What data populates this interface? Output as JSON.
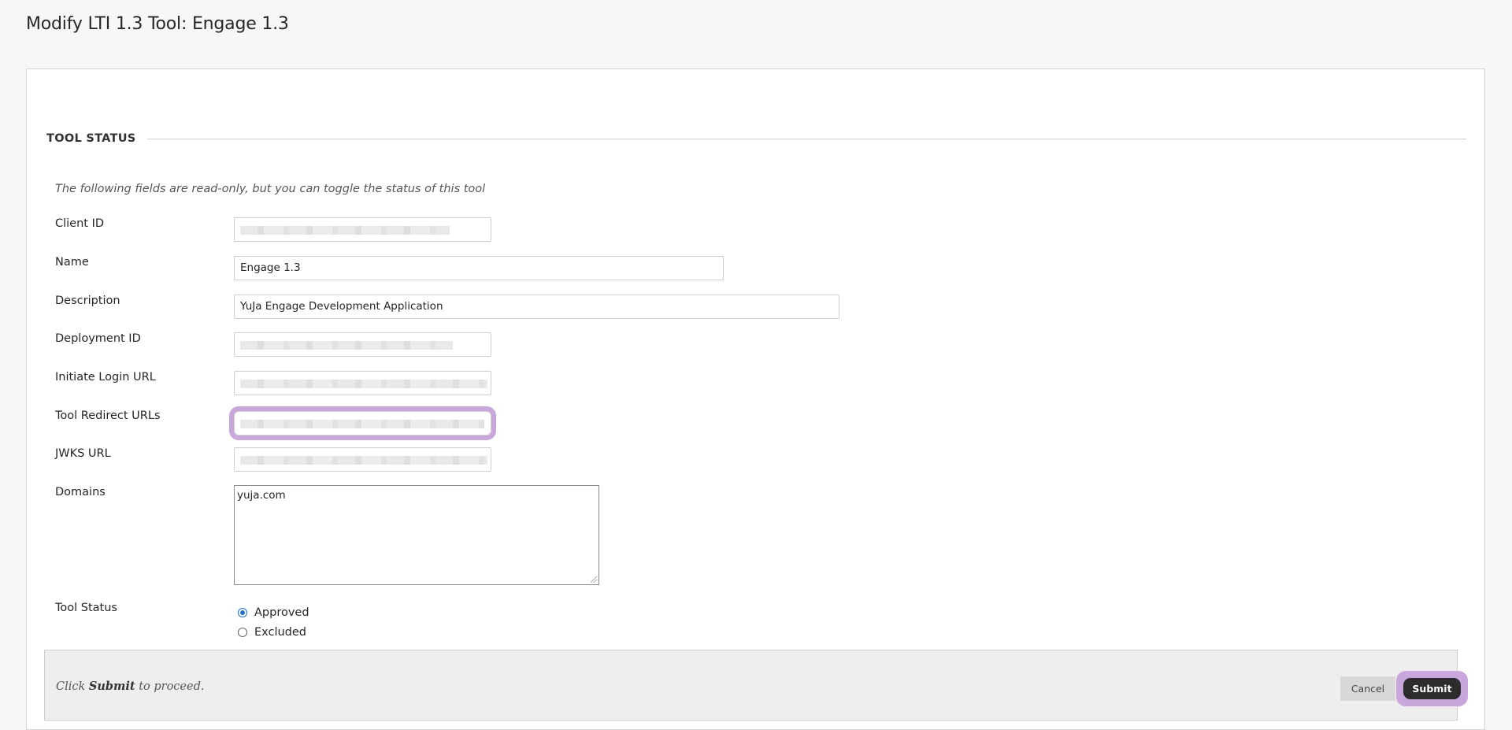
{
  "page": {
    "title": "Modify LTI 1.3 Tool: Engage 1.3"
  },
  "section": {
    "title": "TOOL STATUS",
    "intro": "The following fields are read-only, but you can toggle the status of this tool"
  },
  "fields": {
    "client_id": {
      "label": "Client ID",
      "value": ""
    },
    "name": {
      "label": "Name",
      "value": "Engage 1.3"
    },
    "description": {
      "label": "Description",
      "value": "YuJa Engage Development Application"
    },
    "deployment_id": {
      "label": "Deployment ID",
      "value": ""
    },
    "initiate_login_url": {
      "label": "Initiate Login URL",
      "value": ""
    },
    "tool_redirect_urls": {
      "label": "Tool Redirect URLs",
      "value": ""
    },
    "jwks_url": {
      "label": "JWKS URL",
      "value": ""
    },
    "domains": {
      "label": "Domains",
      "value": "yuja.com"
    }
  },
  "tool_status": {
    "label": "Tool Status",
    "options": [
      {
        "label": "Approved",
        "selected": true
      },
      {
        "label": "Excluded",
        "selected": false
      }
    ]
  },
  "footer": {
    "prefix": "Click",
    "emphasis": "Submit",
    "suffix": "to proceed.",
    "cancel_label": "Cancel",
    "submit_label": "Submit"
  },
  "colors": {
    "highlight": "#c9a7dd",
    "radio_selected": "#1a6fd9",
    "submit_bg": "#2c2c2c"
  }
}
